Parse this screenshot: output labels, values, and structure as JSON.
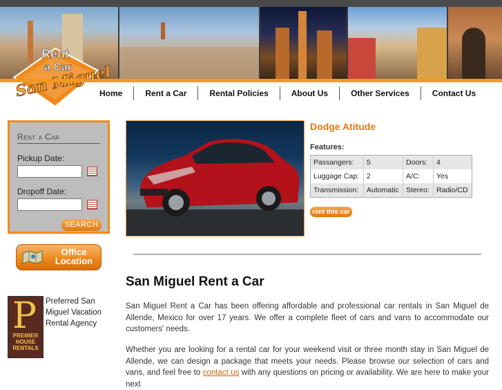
{
  "brand": {
    "logo_line1": "Rent",
    "logo_line2": "a Car",
    "logo_script": "San Miguel"
  },
  "nav": {
    "items": [
      "Home",
      "Rent a Car",
      "Rental Policies",
      "About Us",
      "Other Services",
      "Contact Us"
    ]
  },
  "rent_form": {
    "title": "Rent a Car",
    "pickup_label": "Pickup Date:",
    "pickup_value": "",
    "dropoff_label": "Dropoff Date:",
    "dropoff_value": "",
    "search_label": "SEARCH"
  },
  "office_button": {
    "line1": "Office",
    "line2": "Location"
  },
  "premier": {
    "logo_letter": "P",
    "logo_line1": "PREMIER",
    "logo_line2": "HOUSE",
    "logo_line3": "RENTALS",
    "text": "Preferred San Miguel Vacation Rental Agency"
  },
  "car": {
    "name": "Dodge Atitude",
    "features_label": "Features:",
    "specs": [
      [
        "Passangers:",
        "5",
        "Doors:",
        "4"
      ],
      [
        "Luggage Cap:",
        "2",
        "A/C:",
        "Yes"
      ],
      [
        "Transmission:",
        "Automatic",
        "Stereo:",
        "Radio/CD"
      ]
    ],
    "rent_button": "rent this car",
    "color": "#b3121a"
  },
  "main": {
    "title": "San Miguel Rent a Car",
    "para1": "San Miguel Rent a Car has been offering affordable and professional car rentals in San Miguel de Allende, Mexico for over 17 years. We offer a complete fleet of cars and vans to accommodate our customers' needs.",
    "para2_a": "Whether you are looking for a rental car for your weekend visit or three month stay in San Miguel de Allende, we can design a package that meets your needs. Please browse our selection of cars and vans, and feel free to ",
    "para2_link": "contact us",
    "para2_b": " with any questions on pricing or availability. We are here to make your next"
  },
  "colors": {
    "accent": "#f29a1f",
    "title_orange": "#e8780f",
    "banner_dark": "#3c3c3c"
  }
}
